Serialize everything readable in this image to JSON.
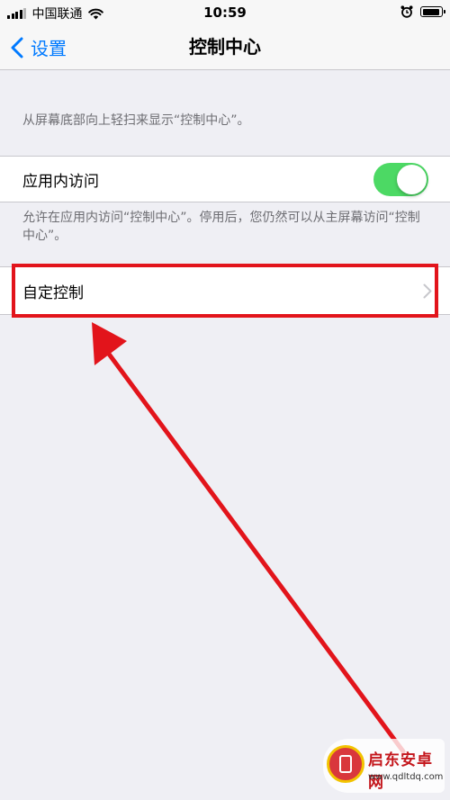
{
  "status_bar": {
    "carrier": "中国联通",
    "time": "10:59",
    "icons": [
      "signal-icon",
      "wifi-icon",
      "alarm-icon",
      "battery-icon"
    ]
  },
  "nav": {
    "back_label": "设置",
    "title": "控制中心"
  },
  "hint_top": "从屏幕底部向上轻扫来显示“控制中心”。",
  "access_row": {
    "label": "应用内访问",
    "toggle_on": true,
    "footer": "允许在应用内访问“控制中心”。停用后，您仍然可以从主屏幕访问“控制中心”。"
  },
  "custom_row": {
    "label": "自定控制"
  },
  "colors": {
    "accent": "#007aff",
    "toggle_on": "#4cd964",
    "annotation": "#e2141b",
    "background": "#efeff4"
  },
  "watermark": {
    "name": "启东安卓网",
    "url": "www.qdltdq.com"
  }
}
